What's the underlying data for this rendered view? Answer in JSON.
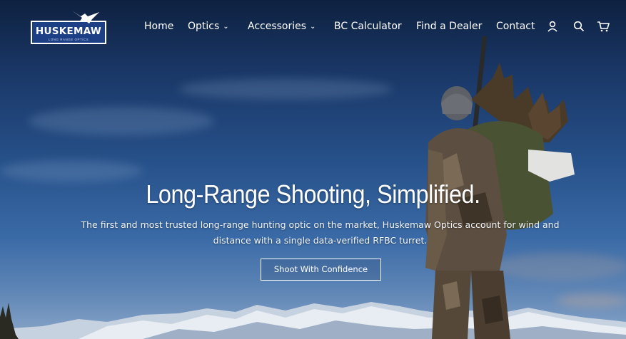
{
  "brand": {
    "name": "HUSKEMAW",
    "tagline": "LONG RANGE OPTICS",
    "color": "#1c3f85"
  },
  "nav": {
    "items": [
      {
        "label": "Home"
      },
      {
        "label": "Optics",
        "dropdown": true
      },
      {
        "label": "Accessories",
        "dropdown": true
      },
      {
        "label": "BC Calculator"
      },
      {
        "label": "Find a Dealer"
      },
      {
        "label": "Contact"
      }
    ],
    "caret": "⌄",
    "icons": [
      "account-icon",
      "search-icon",
      "cart-icon"
    ]
  },
  "hero": {
    "headline": "Long-Range Shooting, Simplified.",
    "subtext_line1": "The first and most trusted long-range hunting optic on the market, Huskemaw Optics account for wind and",
    "subtext_line2": "distance with a single data-verified RFBC turret.",
    "cta_label": "Shoot With Confidence"
  }
}
